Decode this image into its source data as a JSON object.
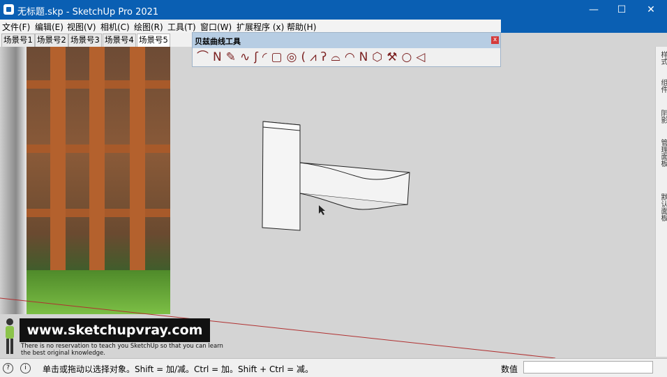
{
  "window": {
    "title": "无标题.skp - SketchUp Pro 2021",
    "minimize": "—",
    "maximize": "☐",
    "close": "✕"
  },
  "menu": [
    "文件(F)",
    "编辑(E)",
    "视图(V)",
    "相机(C)",
    "绘图(R)",
    "工具(T)",
    "窗口(W)",
    "扩展程序 (x)",
    "帮助(H)"
  ],
  "scene_tabs": [
    "场景号1",
    "场景号2",
    "场景号3",
    "场景号4",
    "场景号5"
  ],
  "active_scene_tab": 4,
  "toolbar": {
    "title": "贝兹曲线工具",
    "close": "x",
    "icons": [
      "bezier-curve-icon",
      "polyline-icon",
      "spline-edit-icon",
      "n-curve-icon",
      "s-curve-icon",
      "arc-icon",
      "rectangle-icon",
      "spiral-icon",
      "curve-icon",
      "zigzag-icon",
      "hook-icon",
      "arc-open-icon",
      "half-circle-icon",
      "freehand-icon",
      "polygon-icon",
      "wrench-icon",
      "circle-icon",
      "triangle-icon"
    ]
  },
  "right_panel_tabs": [
    "样式",
    "组件",
    "阴影",
    "管理面板",
    "默认面板"
  ],
  "watermark": {
    "url": "www.sketchupvray.com",
    "line1": "There is no reservation to teach you SketchUp so that you can learn",
    "line2": "the best original knowledge."
  },
  "status": {
    "message": "单击或拖动以选择对象。Shift = 加/减。Ctrl = 加。Shift + Ctrl = 减。",
    "value_label": "数值",
    "value_input": ""
  }
}
